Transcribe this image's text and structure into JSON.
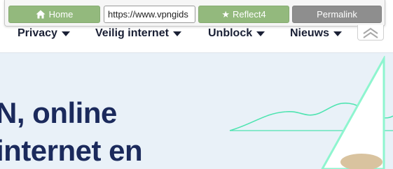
{
  "toolbar": {
    "home_label": "Home",
    "url_value": "https://www.vpngids",
    "reflect_label": "Reflect4",
    "permalink_label": "Permalink",
    "colors": {
      "green": "#93b97d",
      "gray": "#8e8e8e"
    }
  },
  "nav": {
    "items": [
      {
        "label": "Privacy"
      },
      {
        "label": "Veilig internet"
      },
      {
        "label": "Unblock"
      },
      {
        "label": "Nieuws"
      }
    ]
  },
  "hero": {
    "line1": "N, online",
    "line2": "internet en",
    "text_color": "#1b2a5c"
  },
  "icons": {
    "home": "home-icon",
    "star": "star-icon",
    "caret": "caret-down-icon",
    "collapse": "double-chevron-up-icon"
  }
}
